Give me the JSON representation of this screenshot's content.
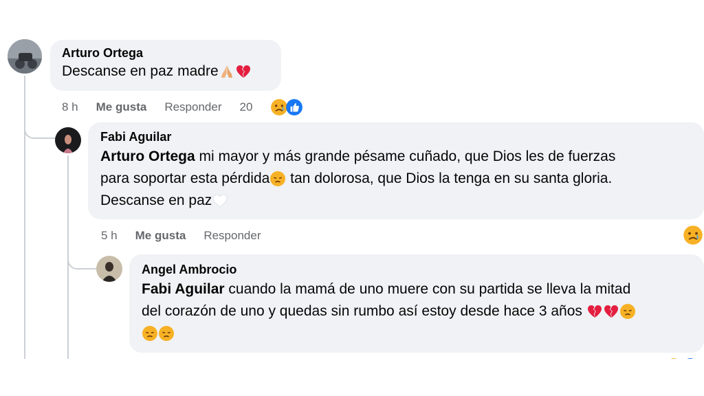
{
  "comments": [
    {
      "author": "Arturo Ortega",
      "text": "Descanse en paz madre",
      "time": "8 h",
      "like_label": "Me gusta",
      "reply_label": "Responder",
      "reaction_count": "20",
      "reactions": [
        "sad-face",
        "like-thumb"
      ],
      "trailing_emojis": [
        "folded-hands",
        "broken-heart"
      ]
    },
    {
      "author": "Fabi Aguilar",
      "mention": "Arturo Ortega",
      "text_line1": " mi mayor y más grande pésame cuñado, que Dios les de fuerzas",
      "text_line2a": "para soportar esta pérdida",
      "text_line2b": " tan dolorosa, que Dios la tenga en su santa gloria.",
      "text_line3": "Descanse en paz",
      "time": "5 h",
      "like_label": "Me gusta",
      "reply_label": "Responder",
      "reactions": [
        "sad-face"
      ]
    },
    {
      "author": "Angel Ambrocio",
      "mention": "Fabi Aguilar",
      "text_line1": " cuando la mamá de uno muere con su partida se lleva la mitad",
      "text_line2": "del corazón de uno y quedas sin rumbo así estoy desde hace 3 años",
      "trailing_emojis": [
        "broken-heart",
        "broken-heart",
        "disappointed-face",
        "disappointed-face",
        "disappointed-face"
      ]
    }
  ],
  "colors": {
    "bubble": "#f0f2f5",
    "meta_text": "#65676b",
    "thread_line": "#ccd0d5",
    "like_blue": "#1877f2",
    "heart_red": "#e41e3f"
  }
}
